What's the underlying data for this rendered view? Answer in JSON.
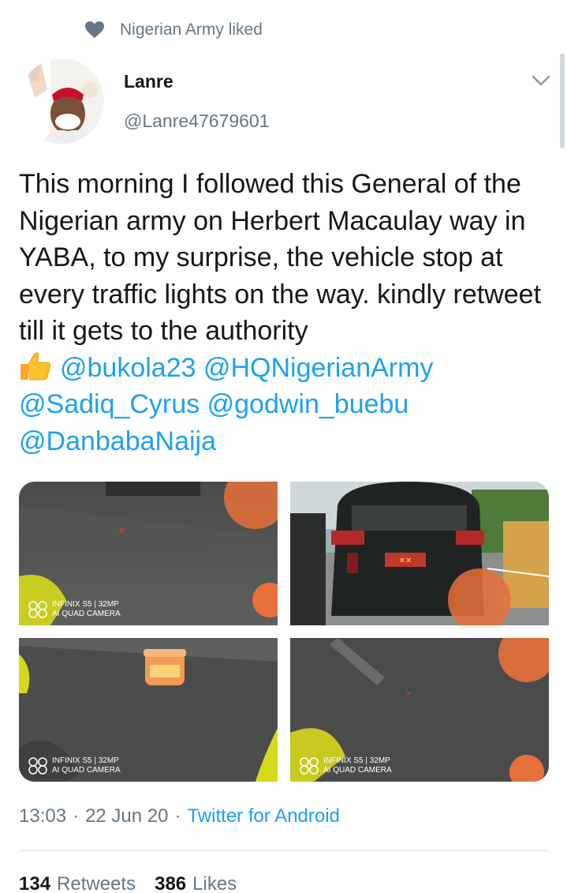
{
  "social_context": {
    "text": "Nigerian Army liked",
    "icon": "heart-icon"
  },
  "author": {
    "name": "Lanre",
    "handle": "@Lanre47679601",
    "avatar": "avatar"
  },
  "tweet": {
    "line1": "This morning I followed this General of the Nigerian army on Herbert Macaulay way in YABA, to my surprise, the vehicle stop at every traffic lights on the way. kindly retweet till it gets to the authority",
    "emoji": "thumbs-up-icon",
    "mentions": [
      "@bukola23",
      "@HQNigerianArmy",
      "@Sadiq_Cyrus",
      "@godwin_buebu",
      "@DanbabaNaija"
    ]
  },
  "media": {
    "watermark_line1": "INFINIX S5 | 32MP",
    "watermark_line2": "AI QUAD CAMERA",
    "plate": "✕✕"
  },
  "meta": {
    "time": "13:03",
    "date": "22 Jun 20",
    "source": "Twitter for Android"
  },
  "stats": {
    "retweets_count": "134",
    "retweets_label": "Retweets",
    "likes_count": "386",
    "likes_label": "Likes"
  },
  "colors": {
    "link": "#1da1f2",
    "secondary": "#657786",
    "primary": "#14171a"
  }
}
